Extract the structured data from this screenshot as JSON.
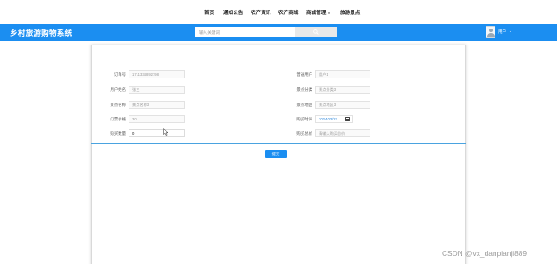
{
  "nav": {
    "items": [
      "首页",
      "通知公告",
      "农产资讯",
      "农产商城",
      "商城管理",
      "旅游景点"
    ]
  },
  "header": {
    "brand": "乡村旅游购物系统",
    "search_placeholder": "输入关键词",
    "user_name": "用户"
  },
  "form": {
    "order_no_label": "订单号",
    "order_no_value": "1711334892798",
    "username_label": "普通用户",
    "username_placeholder": "用户1",
    "user_name_label": "用户姓名",
    "user_name_value": "张三",
    "scenic_category_label": "景点分类",
    "scenic_category_placeholder": "景点分类3",
    "scenic_name_label": "景点名称",
    "scenic_name_placeholder": "景点名称3",
    "scenic_location_label": "景点地区",
    "scenic_location_placeholder": "景点地区3",
    "ticket_price_label": "门票价格",
    "ticket_price_value": "30",
    "purchase_time_label": "购买时间",
    "purchase_time_value": "2024/03/27",
    "purchase_qty_label": "购买数量",
    "purchase_qty_value": "0",
    "purchase_total_label": "购买总价",
    "purchase_total_placeholder": "请输入购买总价",
    "submit_label": "提交"
  },
  "watermark": "CSDN @vx_danpianji889",
  "colors": {
    "brand_blue": "#1b8ef1",
    "divider": "#4aa3e0"
  }
}
